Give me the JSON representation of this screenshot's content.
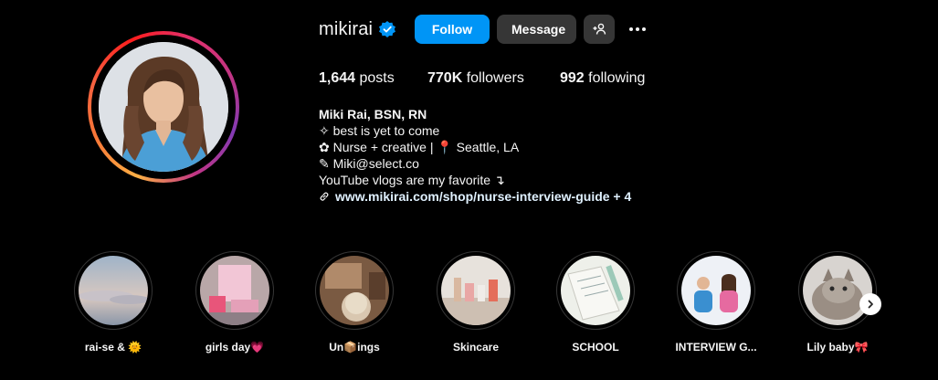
{
  "profile": {
    "username": "mikirai",
    "verified": true,
    "avatar_icon": "profile-photo",
    "follow_label": "Follow",
    "message_label": "Message",
    "add_user_icon": "add-user-icon",
    "more_icon": "more-horizontal-icon"
  },
  "stats": {
    "posts_count": "1,644",
    "posts_label": "posts",
    "followers_count": "770K",
    "followers_label": "followers",
    "following_count": "992",
    "following_label": "following"
  },
  "bio": {
    "name": "Miki Rai, BSN, RN",
    "line1": "✧ best is yet to come",
    "line2": "✿ Nurse + creative | 📍 Seattle, LA",
    "line3": "✎ Miki@select.co",
    "line4": "YouTube vlogs are my favorite ↴",
    "link_text": "www.mikirai.com/shop/nurse-interview-guide + 4"
  },
  "highlights": [
    {
      "label": "rai-se & 🌞"
    },
    {
      "label": "girls day💗"
    },
    {
      "label": "Un📦ings"
    },
    {
      "label": "Skincare"
    },
    {
      "label": "SCHOOL"
    },
    {
      "label": "INTERVIEW G..."
    },
    {
      "label": "Lily baby🎀"
    }
  ],
  "colors": {
    "accent": "#0095f6",
    "button_dark": "#363636",
    "background": "#000000",
    "verified": "#0095f6"
  }
}
